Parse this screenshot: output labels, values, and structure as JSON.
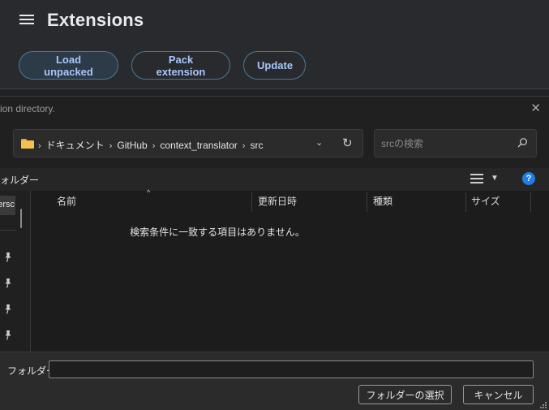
{
  "extensions": {
    "title": "Extensions",
    "buttons": {
      "load_unpacked": "Load unpacked",
      "pack_extension": "Pack extension",
      "update": "Update"
    },
    "accent_color": "#a8c7fa"
  },
  "dialog": {
    "title": "ion directory.",
    "breadcrumb": [
      "ドキュメント",
      "GitHub",
      "context_translator",
      "src"
    ],
    "search_placeholder": "srcの検索",
    "toolbar_label": "ォルダー",
    "nav_label": "ersc",
    "columns": [
      "名前",
      "更新日時",
      "種類",
      "サイズ"
    ],
    "empty_message": "検索条件に一致する項目はありません。",
    "folder_label": "フォルダー:",
    "folder_value": "",
    "select_button": "フォルダーの選択",
    "cancel_button": "キャンセル",
    "help_color": "#1f7ee8"
  }
}
